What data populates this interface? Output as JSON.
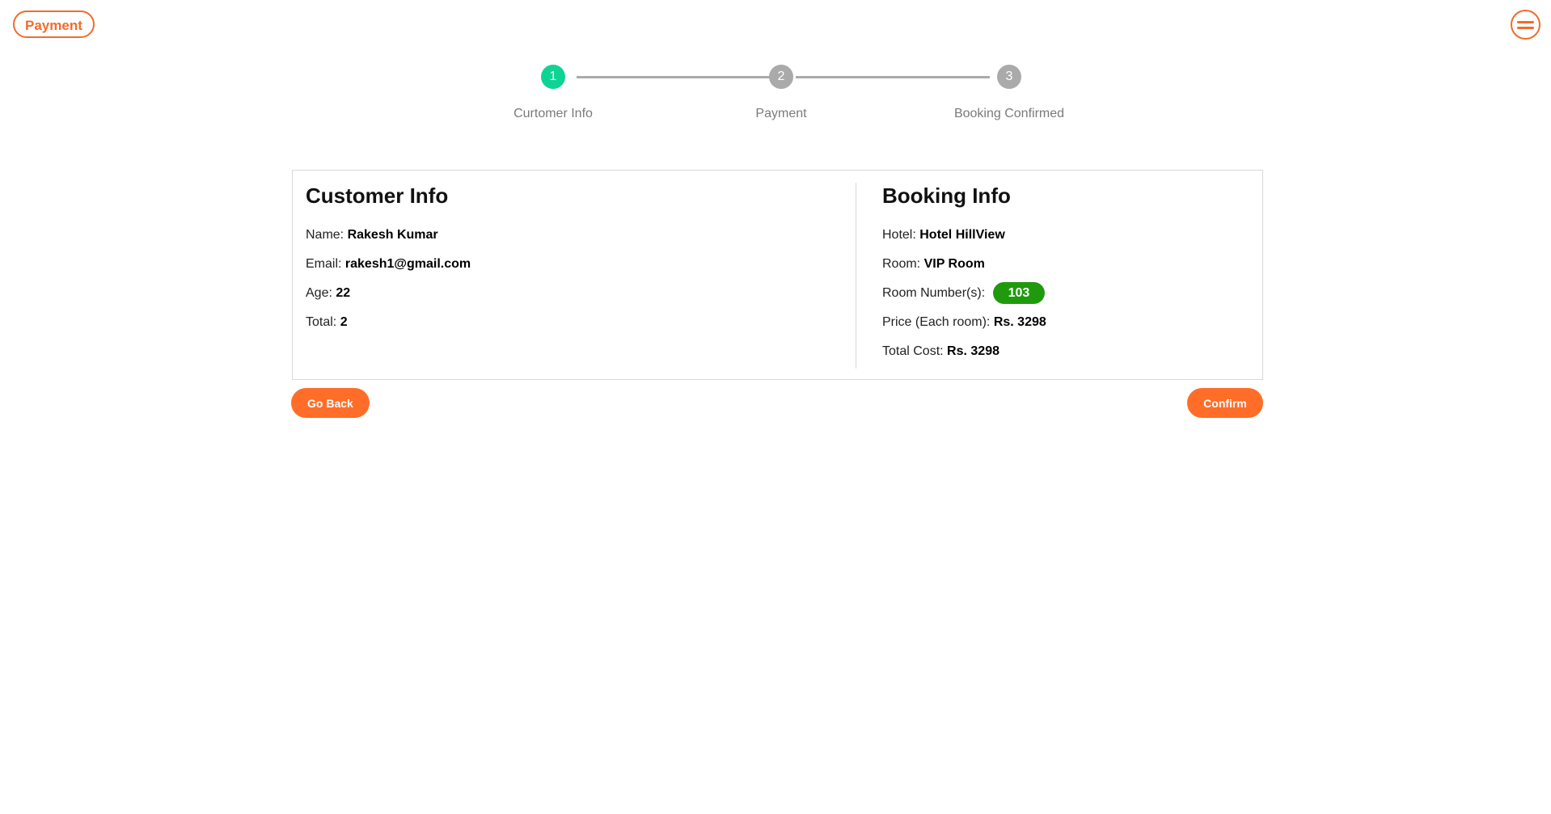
{
  "header": {
    "badge_label": "Payment",
    "menu_icon": "menu-icon"
  },
  "stepper": {
    "steps": [
      {
        "number": "1",
        "label": "Curtomer Info",
        "active": true
      },
      {
        "number": "2",
        "label": "Payment",
        "active": false
      },
      {
        "number": "3",
        "label": "Booking Confirmed",
        "active": false
      }
    ],
    "active_color": "#0fd394",
    "inactive_color": "#aaaaaa"
  },
  "customer": {
    "title": "Customer Info",
    "name_label": "Name:",
    "name": "Rakesh Kumar",
    "email_label": "Email:",
    "email": "rakesh1@gmail.com",
    "age_label": "Age:",
    "age": "22",
    "total_label": "Total:",
    "total": "2"
  },
  "booking": {
    "title": "Booking Info",
    "hotel_label": "Hotel:",
    "hotel": "Hotel HillView",
    "room_label": "Room:",
    "room": "VIP Room",
    "room_numbers_label": "Room Number(s):",
    "room_numbers": [
      "103"
    ],
    "price_label": "Price (Each room):",
    "price": "Rs. 3298",
    "total_cost_label": "Total Cost:",
    "total_cost": "Rs. 3298"
  },
  "actions": {
    "back_label": "Go Back",
    "confirm_label": "Confirm"
  },
  "colors": {
    "accent": "#ff6d29",
    "badge": "#1f9a0c"
  }
}
